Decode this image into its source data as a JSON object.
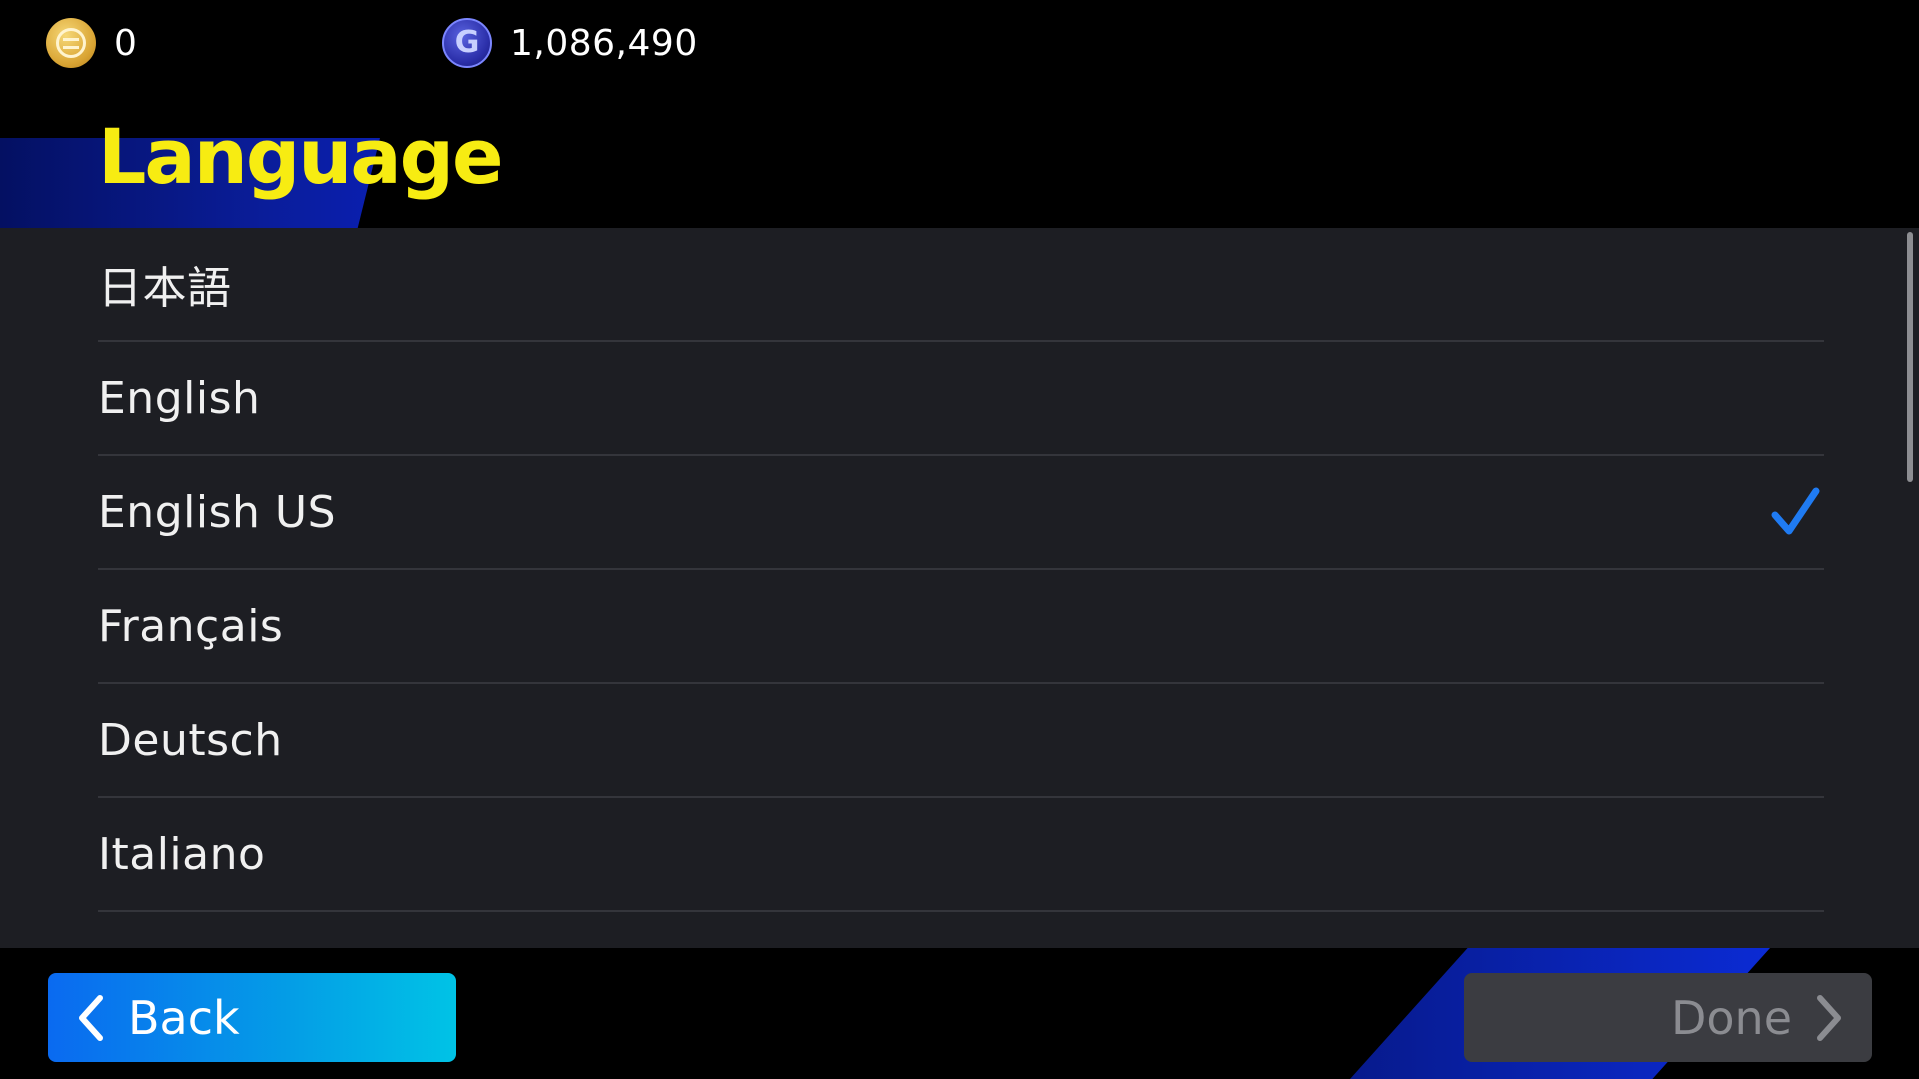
{
  "currencies": {
    "coins": {
      "icon": "ecoin-icon",
      "value": "0"
    },
    "gp": {
      "icon": "gp-icon",
      "glyph": "G",
      "value": "1,086,490"
    }
  },
  "page": {
    "title": "Language"
  },
  "languages": [
    {
      "label": "日本語",
      "selected": false
    },
    {
      "label": "English",
      "selected": false
    },
    {
      "label": "English US",
      "selected": true
    },
    {
      "label": "Français",
      "selected": false
    },
    {
      "label": "Deutsch",
      "selected": false
    },
    {
      "label": "Italiano",
      "selected": false
    }
  ],
  "footer": {
    "back_label": "Back",
    "done_label": "Done"
  },
  "colors": {
    "title": "#f7ec12",
    "check": "#1f7bf2",
    "back_button": "#049ee6",
    "done_button_disabled": "#3b3c41"
  }
}
